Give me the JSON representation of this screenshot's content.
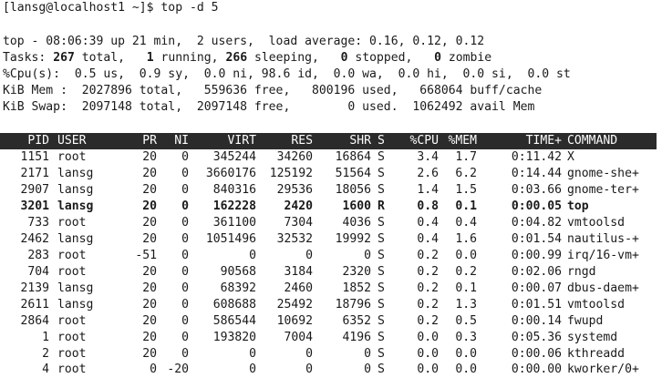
{
  "prompt": "[lansg@localhost1 ~]$ top -d 5",
  "summary": {
    "line1": "top - 08:06:39 up 21 min,  2 users,  load average: 0.16, 0.12, 0.12",
    "tasks_label": "Tasks:",
    "tasks_total": "267",
    "tasks_total_label": " total,",
    "tasks_running": "1",
    "tasks_running_label": " running,",
    "tasks_sleeping": "266",
    "tasks_sleeping_label": " sleeping,",
    "tasks_stopped": "0",
    "tasks_stopped_label": " stopped,",
    "tasks_zombie": "0",
    "tasks_zombie_label": " zombie",
    "cpu_line": "%Cpu(s):  0.5 us,  0.9 sy,  0.0 ni, 98.6 id,  0.0 wa,  0.0 hi,  0.0 si,  0.0 st",
    "mem_line": "KiB Mem :  2027896 total,   559636 free,   800196 used,   668064 buff/cache",
    "swap_line": "KiB Swap:  2097148 total,  2097148 free,        0 used.  1062492 avail Mem"
  },
  "columns": {
    "pid": "PID",
    "user": "USER",
    "pr": "PR",
    "ni": "NI",
    "virt": "VIRT",
    "res": "RES",
    "shr": "SHR",
    "s": "S",
    "cpu": "%CPU",
    "mem": "%MEM",
    "time": "TIME+",
    "command": "COMMAND"
  },
  "processes": [
    {
      "pid": "1151",
      "user": "root",
      "pr": "20",
      "ni": "0",
      "virt": "345244",
      "res": "34260",
      "shr": "16864",
      "s": "S",
      "cpu": "3.4",
      "mem": "1.7",
      "time": "0:11.42",
      "command": "X"
    },
    {
      "pid": "2171",
      "user": "lansg",
      "pr": "20",
      "ni": "0",
      "virt": "3660176",
      "res": "125192",
      "shr": "51564",
      "s": "S",
      "cpu": "2.6",
      "mem": "6.2",
      "time": "0:14.44",
      "command": "gnome-she+"
    },
    {
      "pid": "2907",
      "user": "lansg",
      "pr": "20",
      "ni": "0",
      "virt": "840316",
      "res": "29536",
      "shr": "18056",
      "s": "S",
      "cpu": "1.4",
      "mem": "1.5",
      "time": "0:03.66",
      "command": "gnome-ter+"
    },
    {
      "pid": "3201",
      "user": "lansg",
      "pr": "20",
      "ni": "0",
      "virt": "162228",
      "res": "2420",
      "shr": "1600",
      "s": "R",
      "cpu": "0.8",
      "mem": "0.1",
      "time": "0:00.05",
      "command": "top"
    },
    {
      "pid": "733",
      "user": "root",
      "pr": "20",
      "ni": "0",
      "virt": "361100",
      "res": "7304",
      "shr": "4036",
      "s": "S",
      "cpu": "0.4",
      "mem": "0.4",
      "time": "0:04.82",
      "command": "vmtoolsd"
    },
    {
      "pid": "2462",
      "user": "lansg",
      "pr": "20",
      "ni": "0",
      "virt": "1051496",
      "res": "32532",
      "shr": "19992",
      "s": "S",
      "cpu": "0.4",
      "mem": "1.6",
      "time": "0:01.54",
      "command": "nautilus-+"
    },
    {
      "pid": "283",
      "user": "root",
      "pr": "-51",
      "ni": "0",
      "virt": "0",
      "res": "0",
      "shr": "0",
      "s": "S",
      "cpu": "0.2",
      "mem": "0.0",
      "time": "0:00.99",
      "command": "irq/16-vm+"
    },
    {
      "pid": "704",
      "user": "root",
      "pr": "20",
      "ni": "0",
      "virt": "90568",
      "res": "3184",
      "shr": "2320",
      "s": "S",
      "cpu": "0.2",
      "mem": "0.2",
      "time": "0:02.06",
      "command": "rngd"
    },
    {
      "pid": "2139",
      "user": "lansg",
      "pr": "20",
      "ni": "0",
      "virt": "68392",
      "res": "2460",
      "shr": "1852",
      "s": "S",
      "cpu": "0.2",
      "mem": "0.1",
      "time": "0:00.07",
      "command": "dbus-daem+"
    },
    {
      "pid": "2611",
      "user": "lansg",
      "pr": "20",
      "ni": "0",
      "virt": "608688",
      "res": "25492",
      "shr": "18796",
      "s": "S",
      "cpu": "0.2",
      "mem": "1.3",
      "time": "0:01.51",
      "command": "vmtoolsd"
    },
    {
      "pid": "2864",
      "user": "root",
      "pr": "20",
      "ni": "0",
      "virt": "586544",
      "res": "10692",
      "shr": "6352",
      "s": "S",
      "cpu": "0.2",
      "mem": "0.5",
      "time": "0:00.14",
      "command": "fwupd"
    },
    {
      "pid": "1",
      "user": "root",
      "pr": "20",
      "ni": "0",
      "virt": "193820",
      "res": "7004",
      "shr": "4196",
      "s": "S",
      "cpu": "0.0",
      "mem": "0.3",
      "time": "0:05.36",
      "command": "systemd"
    },
    {
      "pid": "2",
      "user": "root",
      "pr": "20",
      "ni": "0",
      "virt": "0",
      "res": "0",
      "shr": "0",
      "s": "S",
      "cpu": "0.0",
      "mem": "0.0",
      "time": "0:00.06",
      "command": "kthreadd"
    },
    {
      "pid": "4",
      "user": "root",
      "pr": "0",
      "ni": "-20",
      "virt": "0",
      "res": "0",
      "shr": "0",
      "s": "S",
      "cpu": "0.0",
      "mem": "0.0",
      "time": "0:00.00",
      "command": "kworker/0+"
    }
  ]
}
